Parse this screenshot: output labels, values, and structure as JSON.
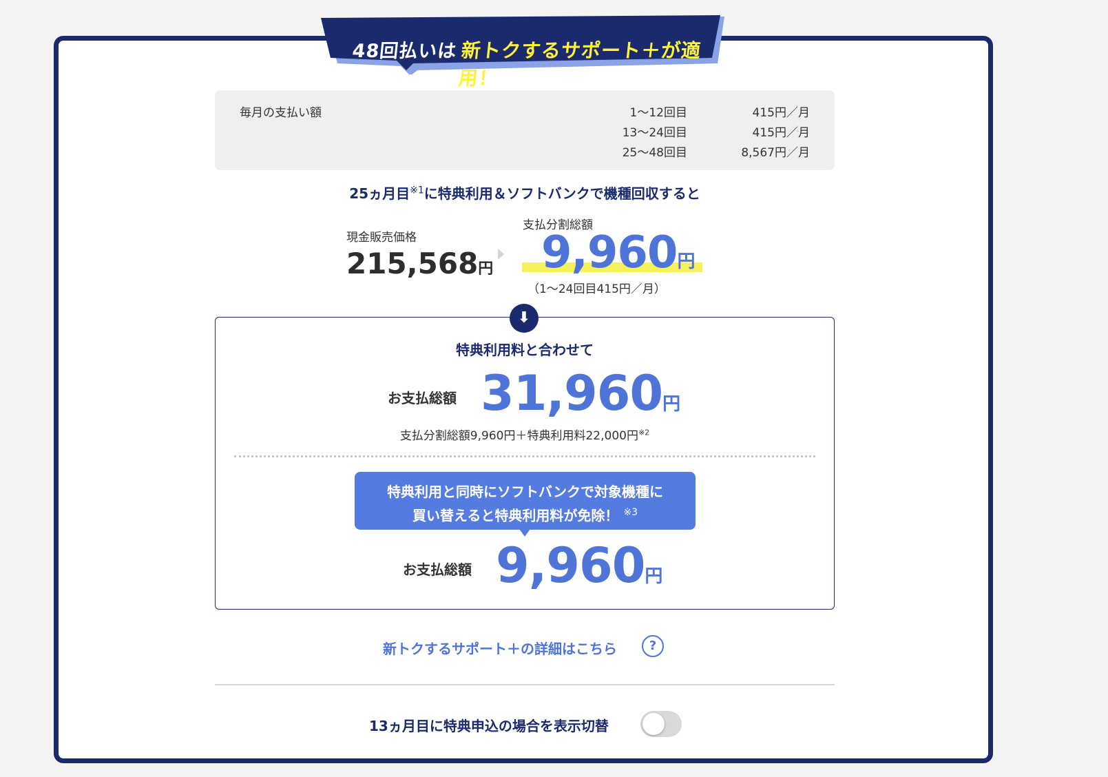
{
  "banner": {
    "left_text": "48回払いは",
    "right_text": "新トクするサポート＋が適用！",
    "colors": {
      "navy": "#1a2a6c",
      "yellow": "#fff23c",
      "shadow": "#8aa3e6"
    }
  },
  "monthly": {
    "label": "毎月の支払い額",
    "rows": [
      {
        "period": "1〜12回目",
        "price": "415円／月"
      },
      {
        "period": "13〜24回目",
        "price": "415円／月"
      },
      {
        "period": "25〜48回目",
        "price": "8,567円／月"
      }
    ]
  },
  "headline": {
    "prefix": "25ヵ月目",
    "note": "※1",
    "suffix": "に特典利用＆ソフトバンクで機種回収すると"
  },
  "cash": {
    "label": "現金販売価格",
    "value": "215,568",
    "unit": "円"
  },
  "installment": {
    "label": "支払分割総額",
    "value": "9,960",
    "unit": "円",
    "note": "（1〜24回目415円／月）"
  },
  "total_box": {
    "heading": "特典利用料と合わせて",
    "total_label": "お支払総額",
    "total_value": "31,960",
    "total_unit": "円",
    "breakdown": "支払分割総額9,960円＋特典利用料22,000円",
    "breakdown_note": "※2",
    "bubble_line1": "特典利用と同時にソフトバンクで対象機種に",
    "bubble_line2": "買い替えると特典利用料が免除！",
    "bubble_note": "※3",
    "exempt_label": "お支払総額",
    "exempt_value": "9,960",
    "exempt_unit": "円"
  },
  "detail_link": {
    "label": "新トクするサポート＋の詳細はこちら",
    "icon": "question-icon"
  },
  "toggle": {
    "label": "13ヵ月目に特典申込の場合を表示切替",
    "state": "off"
  },
  "colors": {
    "accent_blue": "#4f74d8",
    "navy": "#1a2a6c",
    "highlight_yellow": "#f6f35a"
  }
}
